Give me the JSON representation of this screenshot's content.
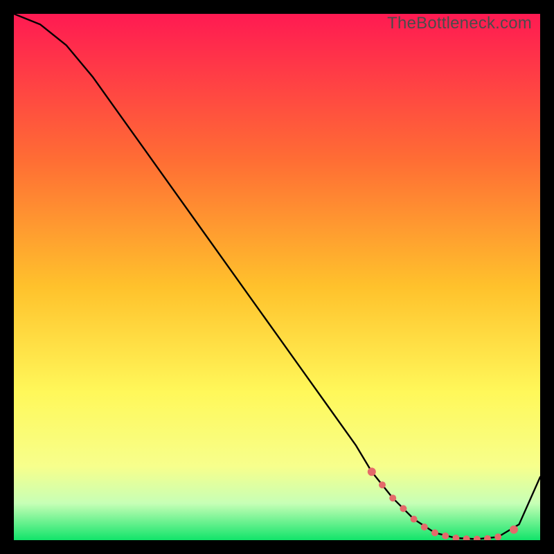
{
  "watermark": "TheBottleneck.com",
  "colors": {
    "gradient_top": "#ff1a52",
    "gradient_mid1": "#ff7e2d",
    "gradient_mid2": "#ffd82b",
    "gradient_mid3": "#fff85a",
    "gradient_mid4": "#f1ffb0",
    "gradient_bottom": "#11e46a",
    "black": "#000000",
    "curve": "#000000",
    "dot": "#e46a6a"
  },
  "chart_data": {
    "type": "line",
    "title": "",
    "xlabel": "",
    "ylabel": "",
    "xlim": [
      0,
      100
    ],
    "ylim": [
      0,
      100
    ],
    "series": [
      {
        "name": "bottleneck-curve",
        "x": [
          0,
          5,
          10,
          15,
          20,
          25,
          30,
          35,
          40,
          45,
          50,
          55,
          60,
          65,
          68,
          72,
          76,
          80,
          84,
          88,
          92,
          96,
          100
        ],
        "y": [
          100,
          98,
          94,
          88,
          81,
          74,
          67,
          60,
          53,
          46,
          39,
          32,
          25,
          18,
          13,
          8,
          4,
          1.4,
          0.4,
          0.2,
          0.6,
          3,
          12
        ]
      }
    ],
    "dots": {
      "name": "highlight-dots",
      "x": [
        68,
        70,
        72,
        74,
        76,
        78,
        80,
        82,
        84,
        86,
        88,
        90,
        92,
        95
      ],
      "y": [
        13,
        10.5,
        8,
        6,
        4,
        2.5,
        1.4,
        0.8,
        0.4,
        0.25,
        0.2,
        0.3,
        0.6,
        2.0
      ]
    }
  }
}
